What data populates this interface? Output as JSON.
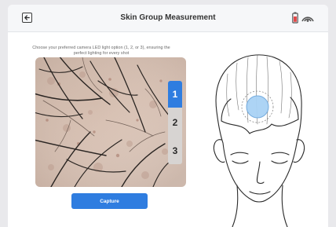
{
  "header": {
    "title": "Skin Group Measurement",
    "back_icon": "arrow-left-icon",
    "status_icons": [
      "battery-icon",
      "wifi-signal-icon"
    ]
  },
  "instruction": "Choose your preferred camera LED light option (1, 2, or 3), ensuring the perfect lighting for every shot",
  "led_options": [
    "1",
    "2",
    "3"
  ],
  "selected_led": "1",
  "capture_label": "Capture",
  "colors": {
    "accent": "#2f7de0",
    "measurement_spot": "#a9d2f5"
  }
}
